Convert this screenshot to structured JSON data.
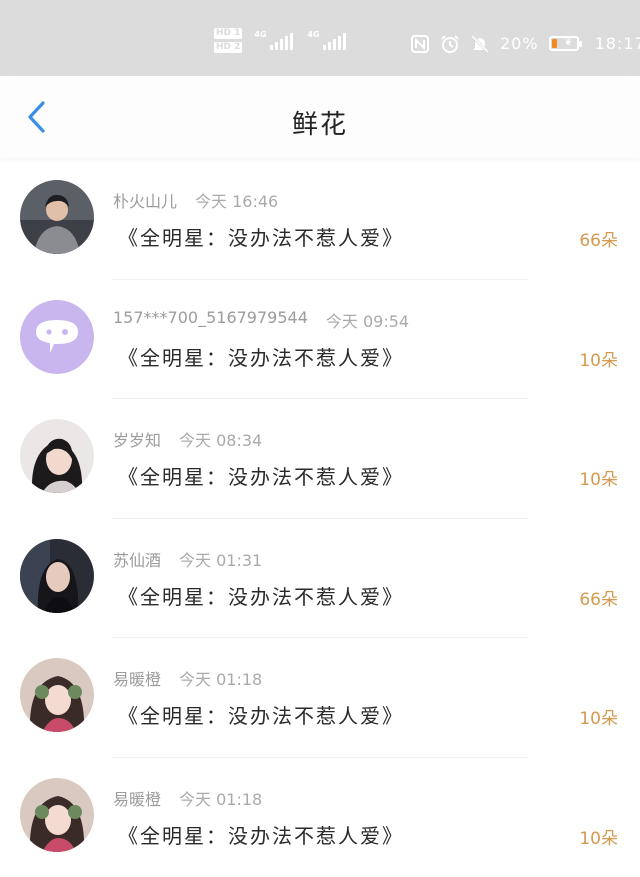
{
  "status_bar": {
    "sim1_label": "HD 1",
    "sim2_label": "HD 2",
    "net1": "4G",
    "net2": "4G",
    "icons": [
      "nfc-icon",
      "alarm-icon",
      "bell-off-icon"
    ],
    "battery_percent": "20%",
    "battery_level": 0.2,
    "time": "18:17"
  },
  "header": {
    "back_icon": "chevron-left-icon",
    "title": "鲜花"
  },
  "colors": {
    "accent_back": "#3a8ee6",
    "count_color": "#d49a4e"
  },
  "gifts": [
    {
      "name": "朴火山儿",
      "time": "今天 16:46",
      "gift": "《全明星：没办法不惹人爱》",
      "count": "66朵",
      "avatar": "avatar-man-gray-shirt"
    },
    {
      "name": "157***700_5167979544",
      "time": "今天 09:54",
      "gift": "《全明星：没办法不惹人爱》",
      "count": "10朵",
      "avatar": "default-chat-bubble-avatar"
    },
    {
      "name": "岁岁知",
      "time": "今天 08:34",
      "gift": "《全明星：没办法不惹人爱》",
      "count": "10朵",
      "avatar": "avatar-woman-dark-hair"
    },
    {
      "name": "苏仙酒",
      "time": "今天 01:31",
      "gift": "《全明星：没办法不惹人爱》",
      "count": "66朵",
      "avatar": "avatar-woman-black-outfit"
    },
    {
      "name": "易暖橙",
      "time": "今天 01:18",
      "gift": "《全明星：没办法不惹人爱》",
      "count": "10朵",
      "avatar": "avatar-woman-headphones"
    },
    {
      "name": "易暖橙",
      "time": "今天 01:18",
      "gift": "《全明星：没办法不惹人爱》",
      "count": "10朵",
      "avatar": "avatar-woman-headphones"
    }
  ]
}
